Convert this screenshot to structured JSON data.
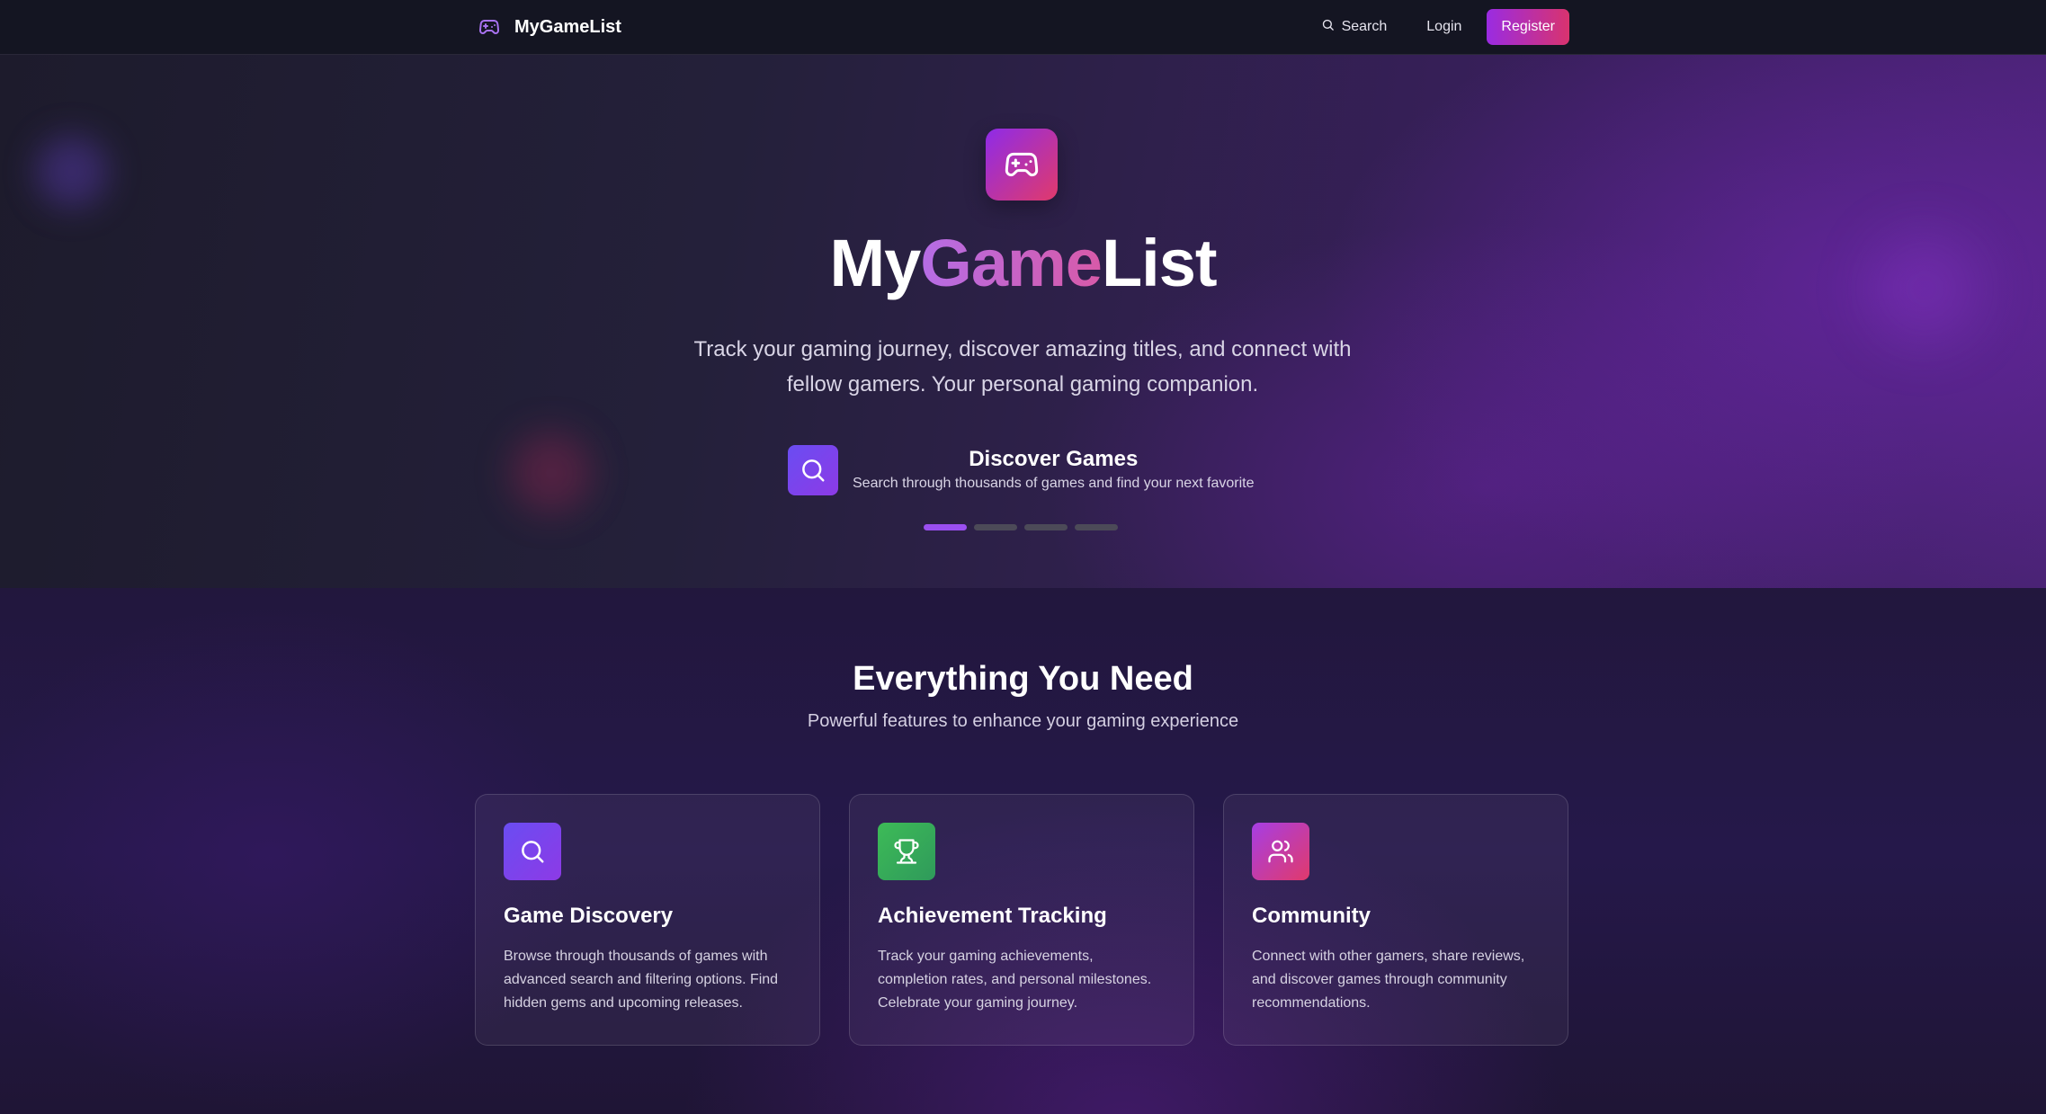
{
  "nav": {
    "brand": "MyGameList",
    "search_label": "Search",
    "login_label": "Login",
    "register_label": "Register"
  },
  "hero": {
    "title_part1": "My",
    "title_part2": "Game",
    "title_part3": "List",
    "subtitle": "Track your gaming journey, discover amazing titles, and connect with fellow gamers. Your personal gaming companion.",
    "slide": {
      "icon": "search-icon",
      "title": "Discover Games",
      "description": "Search through thousands of games and find your next favorite"
    },
    "slides_total": 4,
    "active_slide": 1
  },
  "features": {
    "title": "Everything You Need",
    "subtitle": "Powerful features to enhance your gaming experience",
    "cards": [
      {
        "icon": "search-icon",
        "title": "Game Discovery",
        "description": "Browse through thousands of games with advanced search and filtering options. Find hidden gems and upcoming releases."
      },
      {
        "icon": "trophy-icon",
        "title": "Achievement Tracking",
        "description": "Track your gaming achievements, completion rates, and personal milestones. Celebrate your gaming journey."
      },
      {
        "icon": "users-icon",
        "title": "Community",
        "description": "Connect with other gamers, share reviews, and discover games through community recommendations."
      }
    ]
  },
  "colors": {
    "accent_purple": "#9a2be2",
    "accent_pink": "#d9336e",
    "nav_bg": "#141522"
  }
}
